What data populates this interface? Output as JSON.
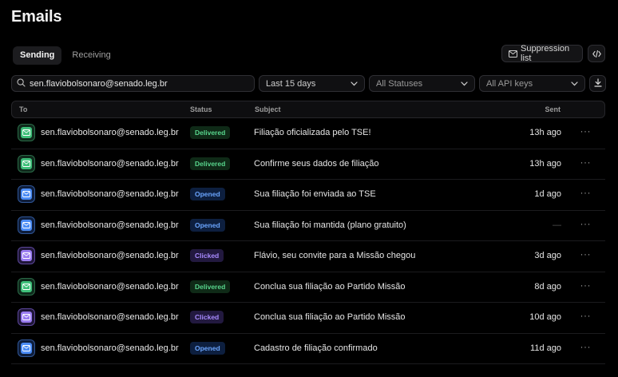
{
  "page": {
    "title": "Emails"
  },
  "tabs": [
    {
      "label": "Sending",
      "active": true
    },
    {
      "label": "Receiving",
      "active": false
    }
  ],
  "actions": {
    "suppression_label": "Suppression list",
    "code_icon": "code-icon"
  },
  "filters": {
    "search_value": "sen.flaviobolsonaro@senado.leg.br",
    "date_range": "Last 15 days",
    "status": "All Statuses",
    "api_keys": "All API keys"
  },
  "table": {
    "columns": {
      "to": "To",
      "status": "Status",
      "subject": "Subject",
      "sent": "Sent"
    },
    "rows": [
      {
        "to": "sen.flaviobolsonaro@senado.leg.br",
        "status": "Delivered",
        "subject": "Filiação oficializada pelo TSE!",
        "sent": "13h ago"
      },
      {
        "to": "sen.flaviobolsonaro@senado.leg.br",
        "status": "Delivered",
        "subject": "Confirme seus dados de filiação",
        "sent": "13h ago"
      },
      {
        "to": "sen.flaviobolsonaro@senado.leg.br",
        "status": "Opened",
        "subject": "Sua filiação foi enviada ao TSE",
        "sent": "1d ago"
      },
      {
        "to": "sen.flaviobolsonaro@senado.leg.br",
        "status": "Opened",
        "subject": "Sua filiação foi mantida (plano gratuito)",
        "sent": "—"
      },
      {
        "to": "sen.flaviobolsonaro@senado.leg.br",
        "status": "Clicked",
        "subject": "Flávio, seu convite para a Missão chegou",
        "sent": "3d ago"
      },
      {
        "to": "sen.flaviobolsonaro@senado.leg.br",
        "status": "Delivered",
        "subject": "Conclua sua filiação ao Partido Missão",
        "sent": "8d ago"
      },
      {
        "to": "sen.flaviobolsonaro@senado.leg.br",
        "status": "Clicked",
        "subject": "Conclua sua filiação ao Partido Missão",
        "sent": "10d ago"
      },
      {
        "to": "sen.flaviobolsonaro@senado.leg.br",
        "status": "Opened",
        "subject": "Cadastro de filiação confirmado",
        "sent": "11d ago"
      }
    ],
    "more_glyph": "···"
  },
  "colors": {
    "delivered": "#58d68d",
    "opened": "#6aa5ff",
    "clicked": "#a88bff",
    "background": "#000000"
  }
}
